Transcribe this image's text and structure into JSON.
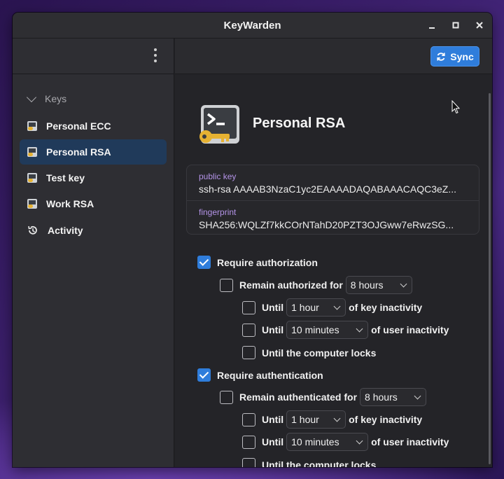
{
  "window": {
    "title": "KeyWarden"
  },
  "sidebar": {
    "section_label": "Keys",
    "items": [
      {
        "label": "Personal ECC",
        "icon": "key-file-icon"
      },
      {
        "label": "Personal RSA",
        "icon": "key-file-icon",
        "selected": true
      },
      {
        "label": "Test key",
        "icon": "key-file-icon"
      },
      {
        "label": "Work RSA",
        "icon": "key-file-icon"
      },
      {
        "label": "Activity",
        "icon": "history-icon"
      }
    ]
  },
  "header": {
    "sync_label": "Sync"
  },
  "key": {
    "name": "Personal RSA",
    "public_key_label": "public key",
    "public_key_value": "ssh-rsa AAAAB3NzaC1yc2EAAAADAQABAAACAQC3eZ...",
    "fingerprint_label": "fingerprint",
    "fingerprint_value": "SHA256:WQLZf7kkCOrNTahD20PZT3OJGww7eRwzSG..."
  },
  "authorization": {
    "require_label": "Require authorization",
    "require_checked": true,
    "remain_label": "Remain authorized for",
    "remain_value": "8 hours",
    "until1_label": "Until",
    "until1_value": "1 hour",
    "until1_suffix": "of key inactivity",
    "until2_label": "Until",
    "until2_value": "10 minutes",
    "until2_suffix": "of user inactivity",
    "lock_label": "Until the computer locks"
  },
  "authentication": {
    "require_label": "Require authentication",
    "require_checked": true,
    "remain_label": "Remain authenticated for",
    "remain_value": "8 hours",
    "until1_label": "Until",
    "until1_value": "1 hour",
    "until1_suffix": "of key inactivity",
    "until2_label": "Until",
    "until2_value": "10 minutes",
    "until2_suffix": "of user inactivity",
    "lock_label": "Until the computer locks"
  },
  "colors": {
    "accent": "#2f7ddb",
    "label_purple": "#b494e8",
    "selected_row": "#203a5a"
  }
}
